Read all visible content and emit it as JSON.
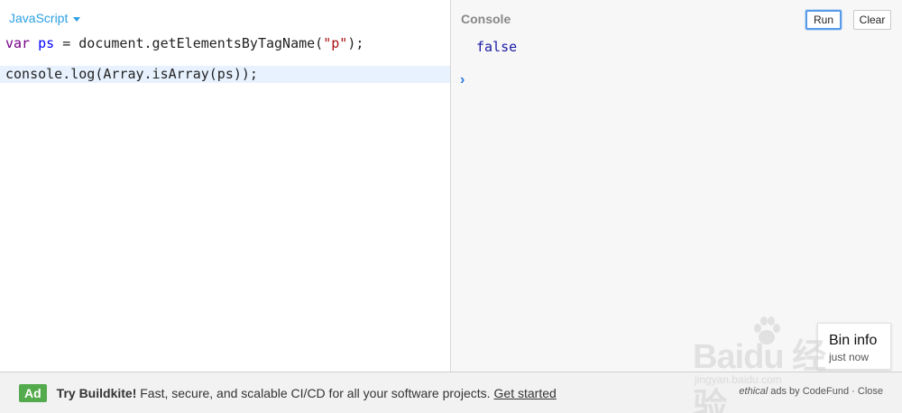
{
  "editor": {
    "language": "JavaScript",
    "code": {
      "line1": {
        "keyword": "var",
        "variable": "ps",
        "op": " = ",
        "call": "document.getElementsByTagName(",
        "arg": "\"p\"",
        "end": ");"
      },
      "line3": "console.log(Array.isArray(ps));"
    }
  },
  "console": {
    "title": "Console",
    "run_label": "Run",
    "clear_label": "Clear",
    "output": "false",
    "prompt": "›"
  },
  "bin_info": {
    "title": "Bin info",
    "subtitle": "just now"
  },
  "ad": {
    "badge": "Ad",
    "headline": "Try Buildkite!",
    "body": " Fast, secure, and scalable CI/CD for all your software projects.",
    "cta": "Get started",
    "meta_ethical": "ethical",
    "meta_rest": " ads by CodeFund · ",
    "close": "Close"
  },
  "watermark": {
    "brand": "Baidu 经验",
    "url": "jingyan.baidu.com"
  },
  "colors": {
    "accent": "#2aa0e4",
    "ad_badge": "#54ab4d",
    "keyword": "#770088",
    "string": "#aa1111",
    "console_value": "#1a1aa6"
  }
}
